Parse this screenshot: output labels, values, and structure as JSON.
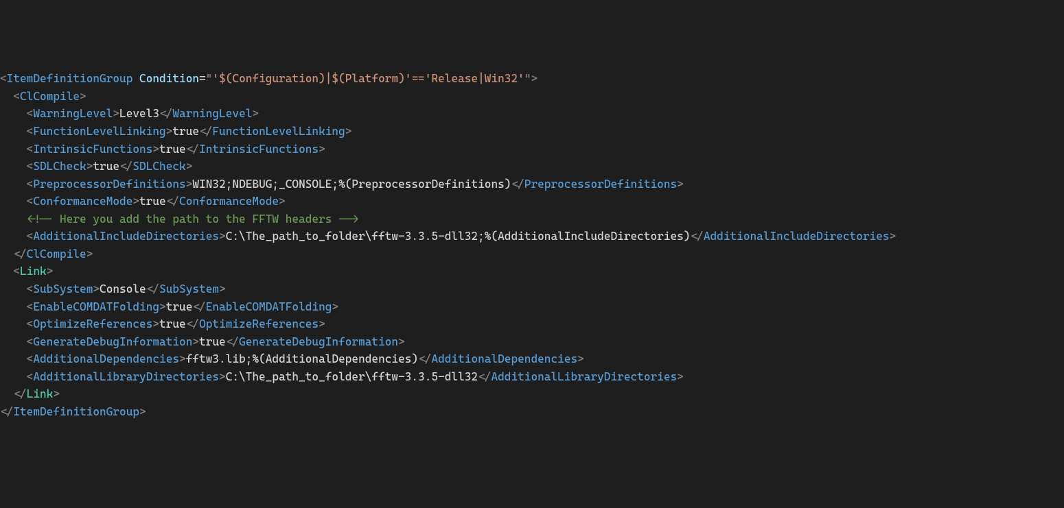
{
  "code": {
    "root": {
      "tag": "ItemDefinitionGroup",
      "attr_name": "Condition",
      "attr_value": "'$(Configuration)|$(Platform)'=='Release|Win32'"
    },
    "clcompile_tag": "ClCompile",
    "link_tag": "Link",
    "clcompile": {
      "warning_level": {
        "tag": "WarningLevel",
        "value": "Level3"
      },
      "function_level_linking": {
        "tag": "FunctionLevelLinking",
        "value": "true"
      },
      "intrinsic_functions": {
        "tag": "IntrinsicFunctions",
        "value": "true"
      },
      "sdl_check": {
        "tag": "SDLCheck",
        "value": "true"
      },
      "preprocessor_definitions": {
        "tag": "PreprocessorDefinitions",
        "value": "WIN32;NDEBUG;_CONSOLE;%(PreprocessorDefinitions)"
      },
      "conformance_mode": {
        "tag": "ConformanceMode",
        "value": "true"
      },
      "comment": " Here you add the path to the FFTW headers ",
      "additional_include_directories": {
        "tag": "AdditionalIncludeDirectories",
        "value": "C:\\The_path_to_folder\\fftw-3.3.5-dll32;%(AdditionalIncludeDirectories)"
      }
    },
    "link": {
      "sub_system": {
        "tag": "SubSystem",
        "value": "Console"
      },
      "enable_comdat_folding": {
        "tag": "EnableCOMDATFolding",
        "value": "true"
      },
      "optimize_references": {
        "tag": "OptimizeReferences",
        "value": "true"
      },
      "generate_debug_information": {
        "tag": "GenerateDebugInformation",
        "value": "true"
      },
      "additional_dependencies": {
        "tag": "AdditionalDependencies",
        "value": "fftw3.lib;%(AdditionalDependencies)"
      },
      "additional_library_directories": {
        "tag": "AdditionalLibraryDirectories",
        "value": "C:\\The_path_to_folder\\fftw-3.3.5-dll32"
      }
    }
  }
}
